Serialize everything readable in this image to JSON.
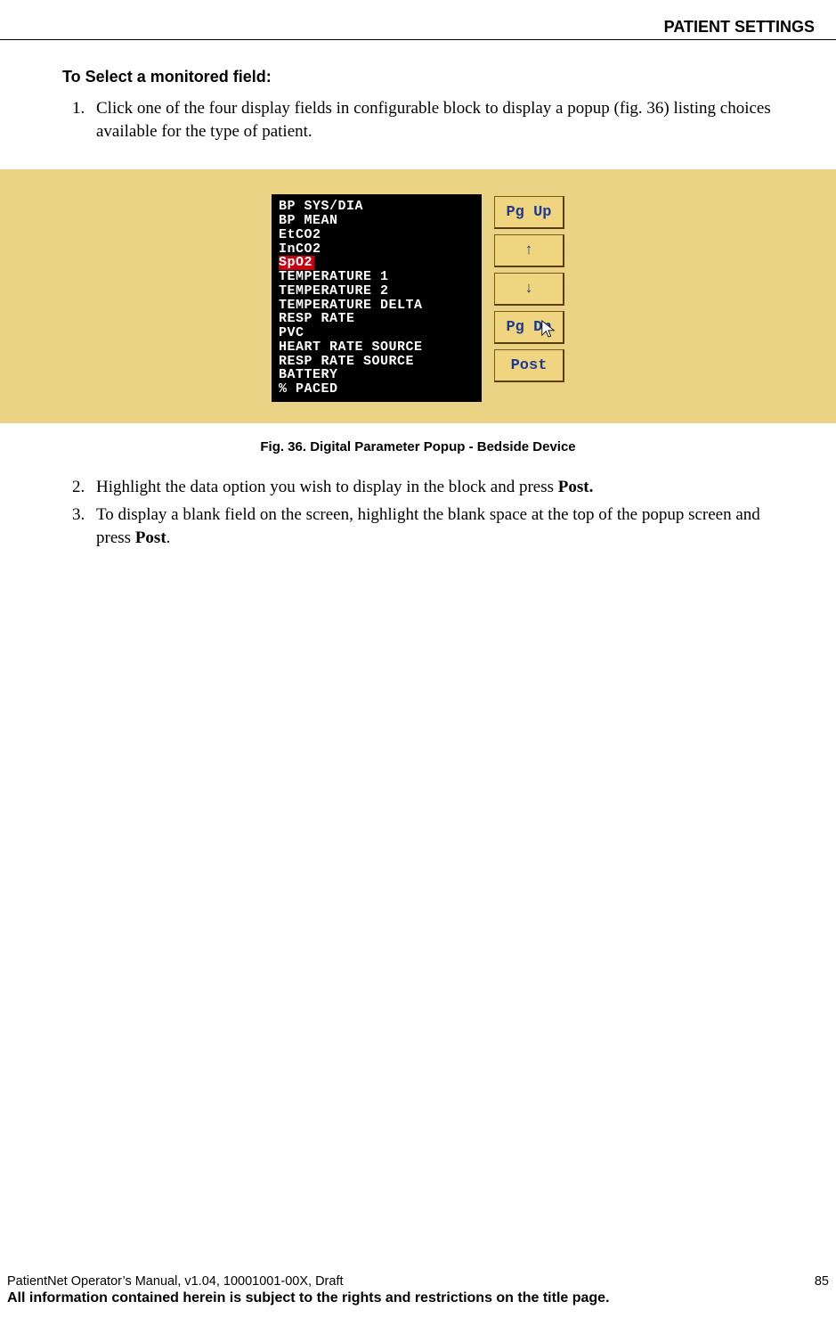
{
  "header": {
    "section_title": "PATIENT SETTINGS"
  },
  "body": {
    "subheading": "To Select a monitored field:",
    "steps": [
      {
        "num": "1.",
        "text": "Click one of the four display fields in configurable block to display a popup (fig. 36) listing choices available for the type of patient."
      },
      {
        "num": "2.",
        "text_before": "Highlight the data option you wish to display in the block and press ",
        "bold": "Post."
      },
      {
        "num": "3.",
        "text_before": "To display a blank field on the screen, highlight the blank space at the top of the popup screen and press ",
        "bold": "Post",
        "text_after": "."
      }
    ],
    "figure_caption": "Fig. 36. Digital Parameter Popup - Bedside Device",
    "popup": {
      "items": [
        "BP SYS/DIA",
        "BP MEAN",
        "EtCO2",
        "InCO2",
        "SpO2",
        "TEMPERATURE 1",
        "TEMPERATURE 2",
        "TEMPERATURE DELTA",
        "RESP RATE",
        "PVC",
        "HEART RATE SOURCE",
        "RESP RATE SOURCE",
        "BATTERY",
        "% PACED"
      ],
      "selected_index": 4,
      "buttons": {
        "pgup": "Pg Up",
        "up": "↑",
        "down": "↓",
        "pgdn": "Pg Dn",
        "post": "Post"
      }
    }
  },
  "footer": {
    "doc_info": "PatientNet Operator’s Manual, v1.04, 10001001-00X, Draft",
    "page_number": "85",
    "rights": "All information contained herein is subject to the rights and restrictions on the title page."
  }
}
